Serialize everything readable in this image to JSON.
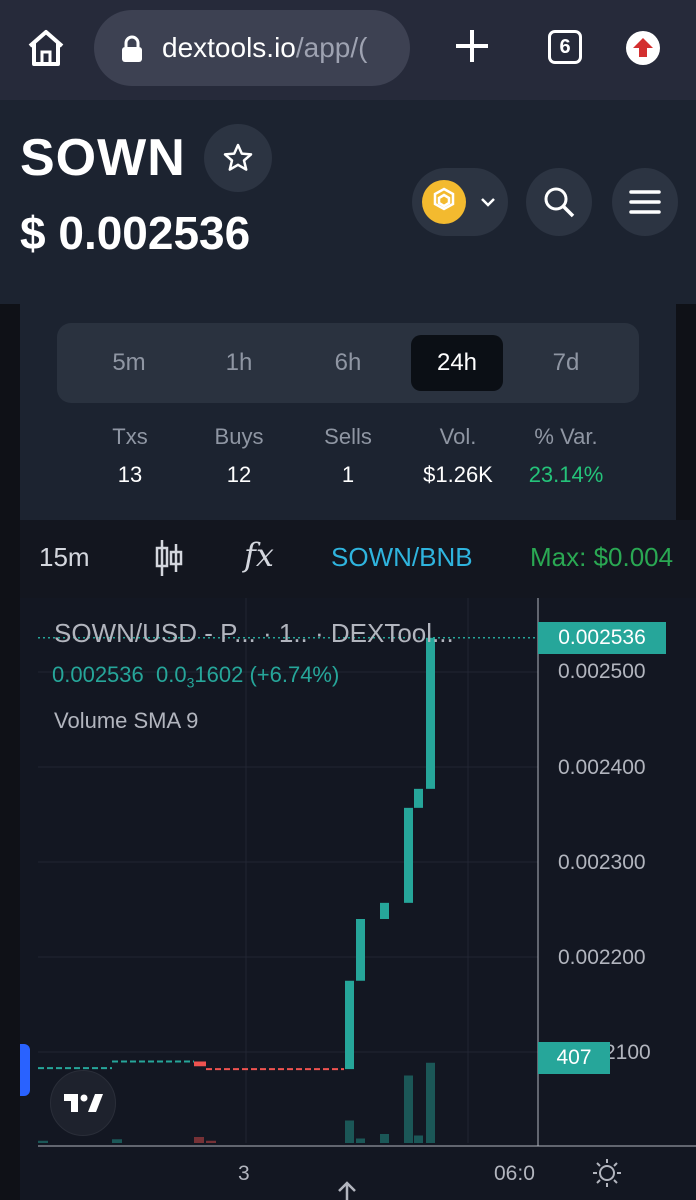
{
  "browser": {
    "url_main": "dextools.io",
    "url_rest": "/app/(",
    "tab_count": "6"
  },
  "token": {
    "symbol": "SOWN",
    "price": "$ 0.002536",
    "chain_logo_color": "#f3ba2f"
  },
  "periods": {
    "tabs": [
      "5m",
      "1h",
      "6h",
      "24h",
      "7d"
    ],
    "active": "24h"
  },
  "stats": [
    {
      "label": "Txs",
      "value": "13"
    },
    {
      "label": "Buys",
      "value": "12"
    },
    {
      "label": "Sells",
      "value": "1"
    },
    {
      "label": "Vol.",
      "value": "$1.26K"
    },
    {
      "label": "% Var.",
      "value": "23.14%"
    }
  ],
  "toolbar": {
    "interval": "15m",
    "fx_icon": "fx",
    "pair": "SOWN/BNB",
    "max": "Max: $0.004"
  },
  "chart": {
    "title": "SOWN/USD - P...  · 1..  · DEXTool...",
    "ohlc_price": "0.002536",
    "ohlc_change_prefix": "0.0",
    "ohlc_change_sub": "3",
    "ohlc_change_rest": "1602 (+6.74%)",
    "indicator": "Volume SMA 9",
    "last_price_badge": "0.002536",
    "last_volume_badge": "407",
    "y_ticks": [
      "0.002500",
      "0.002400",
      "0.002300",
      "0.002200",
      "2100"
    ],
    "x_ticks": [
      "3",
      "06:0"
    ],
    "up_color": "#26a69a",
    "down_color": "#ef5350"
  },
  "chart_data": {
    "type": "candlestick",
    "title": "SOWN/USD",
    "ylabel": "",
    "ylim": [
      0.00202,
      0.00256
    ],
    "candles": [
      {
        "o": 0.002083,
        "h": 0.002086,
        "l": 0.00208,
        "c": 0.002083
      },
      {
        "o": 0.002083,
        "h": 0.002091,
        "l": 0.002083,
        "c": 0.00209
      },
      {
        "o": 0.00209,
        "h": 0.00209,
        "l": 0.002085,
        "c": 0.002085
      },
      {
        "o": 0.002085,
        "h": 0.002085,
        "l": 0.002082,
        "c": 0.002082
      },
      {
        "o": 0.002082,
        "h": 0.002175,
        "l": 0.002082,
        "c": 0.002175
      },
      {
        "o": 0.002175,
        "h": 0.00224,
        "l": 0.002175,
        "c": 0.00224
      },
      {
        "o": 0.00224,
        "h": 0.002257,
        "l": 0.00224,
        "c": 0.002257
      },
      {
        "o": 0.002257,
        "h": 0.002357,
        "l": 0.002257,
        "c": 0.002357
      },
      {
        "o": 0.002357,
        "h": 0.002377,
        "l": 0.002357,
        "c": 0.002377
      },
      {
        "o": 0.002377,
        "h": 0.002545,
        "l": 0.002377,
        "c": 0.002536
      }
    ],
    "volume": [
      3,
      5,
      8,
      3,
      30,
      6,
      12,
      90,
      10,
      107
    ],
    "max_volume_badge": 407
  }
}
